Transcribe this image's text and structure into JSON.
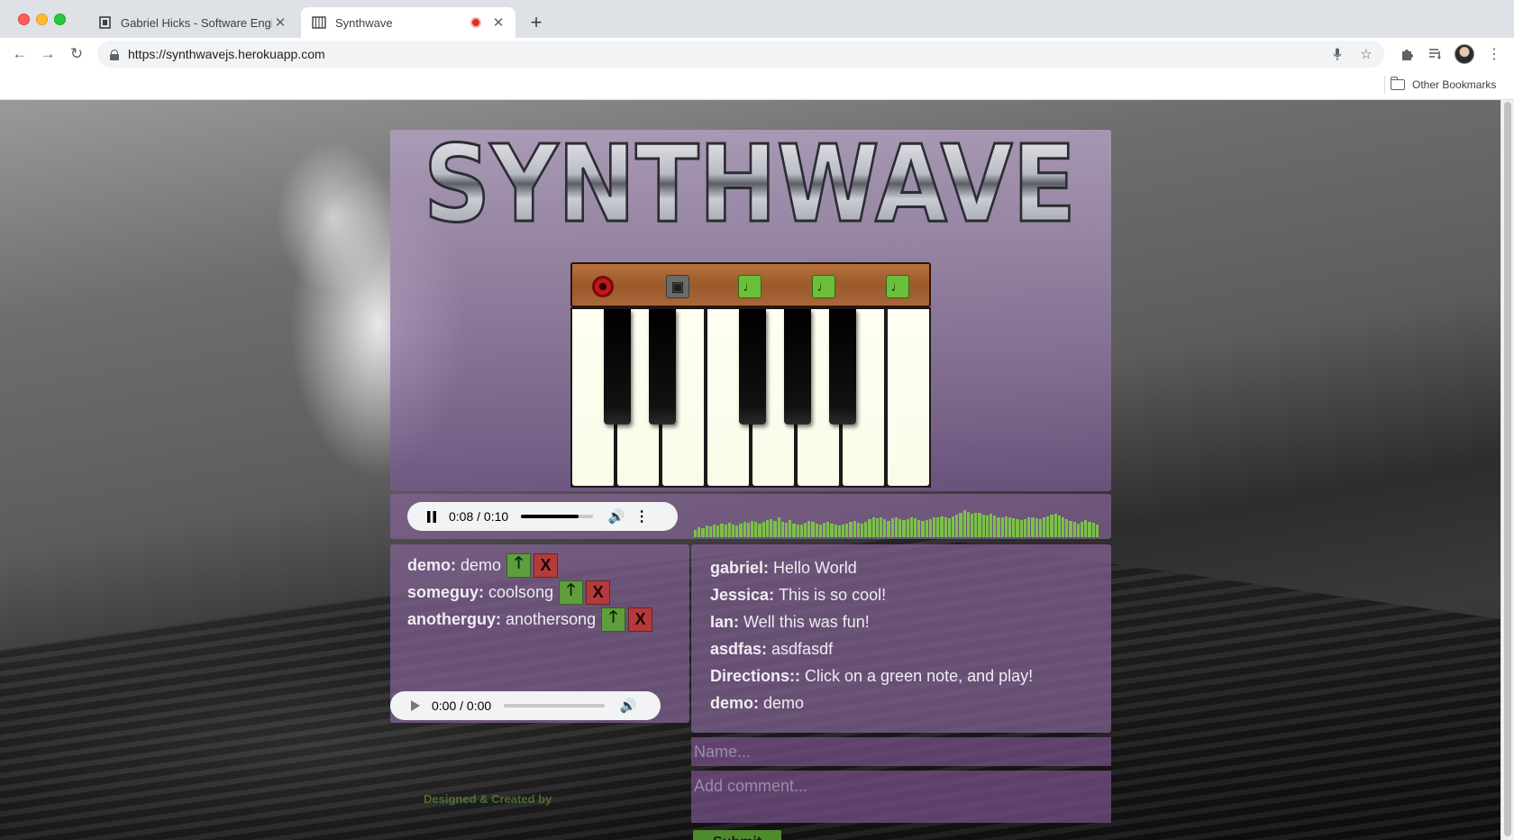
{
  "browser": {
    "tabs": [
      {
        "title": "Gabriel Hicks - Software Engin",
        "favicon": "file-icon",
        "active": false
      },
      {
        "title": "Synthwave",
        "favicon": "piano-icon",
        "active": true,
        "recording": true
      }
    ],
    "url": "https://synthwavejs.herokuapp.com",
    "bookmarks": {
      "other_label": "Other Bookmarks"
    }
  },
  "app": {
    "logo_text": "SYNTHWAVE",
    "controls": {
      "record_icon": "record-icon",
      "stop_symbol": "▣",
      "note_symbol": "♩",
      "note_count": 3
    },
    "piano": {
      "white_keys": 8,
      "black_keys": 5
    },
    "main_player": {
      "time": "0:08 / 0:10",
      "progress": 0.8,
      "playing": true
    },
    "visualizer_levels": [
      0.22,
      0.3,
      0.28,
      0.35,
      0.33,
      0.4,
      0.36,
      0.42,
      0.38,
      0.45,
      0.4,
      0.37,
      0.43,
      0.48,
      0.44,
      0.5,
      0.46,
      0.42,
      0.47,
      0.52,
      0.55,
      0.5,
      0.6,
      0.48,
      0.45,
      0.52,
      0.42,
      0.4,
      0.38,
      0.45,
      0.5,
      0.47,
      0.43,
      0.4,
      0.44,
      0.46,
      0.42,
      0.38,
      0.36,
      0.4,
      0.43,
      0.47,
      0.5,
      0.45,
      0.42,
      0.48,
      0.55,
      0.6,
      0.58,
      0.62,
      0.55,
      0.5,
      0.58,
      0.6,
      0.56,
      0.52,
      0.55,
      0.6,
      0.58,
      0.54,
      0.5,
      0.52,
      0.56,
      0.6,
      0.62,
      0.65,
      0.6,
      0.58,
      0.64,
      0.7,
      0.75,
      0.82,
      0.78,
      0.72,
      0.76,
      0.74,
      0.7,
      0.68,
      0.72,
      0.66,
      0.62,
      0.6,
      0.64,
      0.6,
      0.58,
      0.55,
      0.52,
      0.56,
      0.6,
      0.62,
      0.58,
      0.55,
      0.6,
      0.64,
      0.7,
      0.72,
      0.68,
      0.62,
      0.56,
      0.5,
      0.46,
      0.42,
      0.48,
      0.52,
      0.46,
      0.44,
      0.4
    ],
    "songs": [
      {
        "author": "demo:",
        "name": "demo"
      },
      {
        "author": "someguy:",
        "name": "coolsong"
      },
      {
        "author": "anotherguy:",
        "name": "anothersong"
      }
    ],
    "song_buttons": {
      "upvote": "🡑",
      "delete": "X"
    },
    "secondary_player": {
      "time": "0:00 / 0:00",
      "progress": 0.0
    },
    "comments": [
      {
        "author": "gabriel:",
        "text": "Hello World"
      },
      {
        "author": "Jessica:",
        "text": "This is so cool!"
      },
      {
        "author": "Ian:",
        "text": "Well this was fun!"
      },
      {
        "author": "asdfas:",
        "text": "asdfasdf"
      },
      {
        "author": "Directions::",
        "text": "Click on a green note, and play!"
      },
      {
        "author": "demo:",
        "text": "demo"
      }
    ],
    "name_placeholder": "Name...",
    "comment_placeholder": "Add comment...",
    "submit_label": "Submit",
    "credits": "Designed & Created by",
    "accent_green": "#6cbf3a",
    "panel_purple": "#84649a"
  }
}
